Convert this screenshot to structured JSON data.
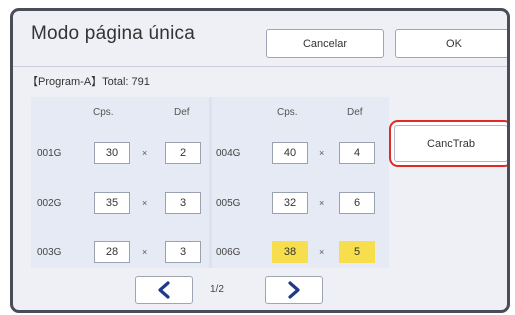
{
  "dialog": {
    "title": "Modo página única",
    "cancel_label": "Cancelar",
    "ok_label": "OK"
  },
  "program": {
    "label": "【Program-A】Total: 791"
  },
  "columns": {
    "copies_header": "Cps.",
    "def_header": "Def",
    "times": "×"
  },
  "rows": [
    {
      "id": "001G",
      "copies": "30",
      "def": "2"
    },
    {
      "id": "002G",
      "copies": "35",
      "def": "3"
    },
    {
      "id": "003G",
      "copies": "28",
      "def": "3"
    },
    {
      "id": "004G",
      "copies": "40",
      "def": "4"
    },
    {
      "id": "005G",
      "copies": "32",
      "def": "6"
    },
    {
      "id": "006G",
      "copies": "38",
      "def": "5",
      "highlighted": true
    }
  ],
  "side": {
    "cancel_job_label": "CancTrab"
  },
  "pagination": {
    "page": "1/2",
    "prev_icon": "chevron-left-icon",
    "next_icon": "chevron-right-icon"
  },
  "colors": {
    "highlight": "#f6de4d",
    "selected_outline": "#e02a2a",
    "arrow": "#1f3a8a"
  }
}
